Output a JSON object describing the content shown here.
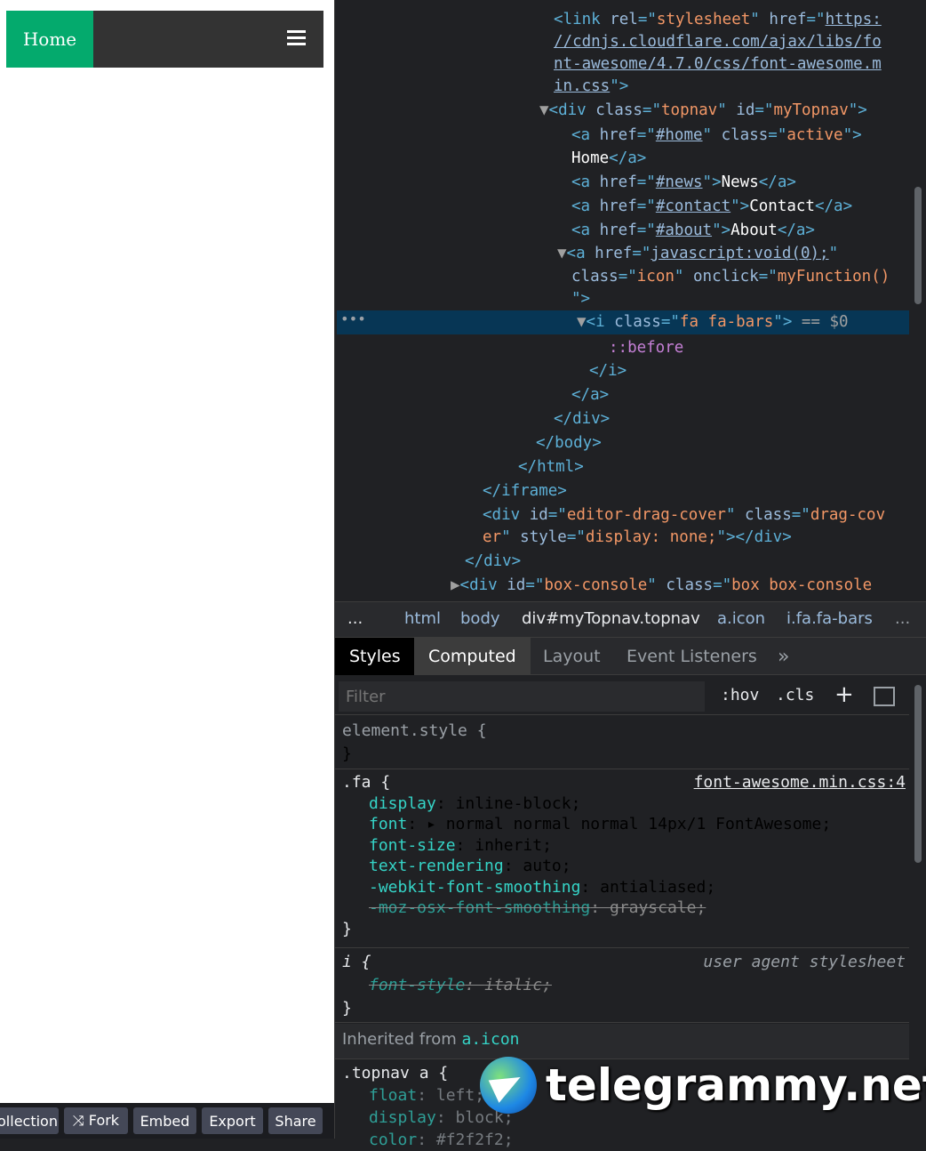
{
  "preview": {
    "nav_home": "Home",
    "menu_icon": "bars-icon"
  },
  "bottom_bar": {
    "collection": "ollection",
    "fork": "⤨ Fork",
    "embed": "Embed",
    "export": "Export",
    "share": "Share"
  },
  "elements_tree": [
    [
      [
        "t",
        "<link "
      ],
      [
        "an",
        "rel"
      ],
      [
        "t",
        "=\""
      ],
      [
        "av",
        "stylesheet"
      ],
      [
        "t",
        "\" "
      ],
      [
        "an",
        "href"
      ],
      [
        "t",
        "=\""
      ],
      [
        "lk",
        "https:"
      ]
    ],
    [
      [
        "lk",
        "//cdnjs.cloudflare.com/ajax/libs/fo"
      ]
    ],
    [
      [
        "lk",
        "nt-awesome/4.7.0/css/font-awesome.m"
      ]
    ],
    [
      [
        "lk",
        "in.css"
      ],
      [
        "t",
        "\">"
      ]
    ],
    [
      [
        "ar",
        "▼"
      ],
      [
        "t",
        "<div "
      ],
      [
        "an",
        "class"
      ],
      [
        "t",
        "=\""
      ],
      [
        "av",
        "topnav"
      ],
      [
        "t",
        "\" "
      ],
      [
        "an",
        "id"
      ],
      [
        "t",
        "=\""
      ],
      [
        "av",
        "myTopnav"
      ],
      [
        "t",
        "\">"
      ]
    ],
    [
      [
        "t",
        "<a "
      ],
      [
        "an",
        "href"
      ],
      [
        "t",
        "=\""
      ],
      [
        "lk",
        "#home"
      ],
      [
        "t",
        "\" "
      ],
      [
        "an",
        "class"
      ],
      [
        "t",
        "=\""
      ],
      [
        "av",
        "active"
      ],
      [
        "t",
        "\">"
      ]
    ],
    [
      [
        "tx",
        "Home"
      ],
      [
        "t",
        "</a>"
      ]
    ],
    [
      [
        "t",
        "<a "
      ],
      [
        "an",
        "href"
      ],
      [
        "t",
        "=\""
      ],
      [
        "lk",
        "#news"
      ],
      [
        "t",
        "\">"
      ],
      [
        "tx",
        "News"
      ],
      [
        "t",
        "</a>"
      ]
    ],
    [
      [
        "t",
        "<a "
      ],
      [
        "an",
        "href"
      ],
      [
        "t",
        "=\""
      ],
      [
        "lk",
        "#contact"
      ],
      [
        "t",
        "\">"
      ],
      [
        "tx",
        "Contact"
      ],
      [
        "t",
        "</a>"
      ]
    ],
    [
      [
        "t",
        "<a "
      ],
      [
        "an",
        "href"
      ],
      [
        "t",
        "=\""
      ],
      [
        "lk",
        "#about"
      ],
      [
        "t",
        "\">"
      ],
      [
        "tx",
        "About"
      ],
      [
        "t",
        "</a>"
      ]
    ],
    [
      [
        "ar",
        "▼"
      ],
      [
        "t",
        "<a "
      ],
      [
        "an",
        "href"
      ],
      [
        "t",
        "=\""
      ],
      [
        "lk",
        "javascript:void(0);"
      ],
      [
        "t",
        "\""
      ]
    ],
    [
      [
        "an",
        "class"
      ],
      [
        "t",
        "=\""
      ],
      [
        "av",
        "icon"
      ],
      [
        "t",
        "\" "
      ],
      [
        "an",
        "onclick"
      ],
      [
        "t",
        "=\""
      ],
      [
        "av",
        "myFunction()"
      ]
    ],
    [
      [
        "t",
        "\">"
      ]
    ],
    [
      [
        "ar",
        "▼"
      ],
      [
        "t",
        "<i "
      ],
      [
        "an",
        "class"
      ],
      [
        "t",
        "=\""
      ],
      [
        "av",
        "fa fa-bars"
      ],
      [
        "t",
        "\">"
      ],
      [
        "ar",
        " == "
      ],
      [
        "ar",
        "$0"
      ]
    ],
    [
      [
        "ps",
        "::before"
      ]
    ],
    [
      [
        "t",
        "</i>"
      ]
    ],
    [
      [
        "t",
        "</a>"
      ]
    ],
    [
      [
        "t",
        "</div>"
      ]
    ],
    [
      [
        "t",
        "</body>"
      ]
    ],
    [
      [
        "t",
        "</html>"
      ]
    ],
    [
      [
        "t",
        "</iframe>"
      ]
    ],
    [
      [
        "t",
        "<div "
      ],
      [
        "an",
        "id"
      ],
      [
        "t",
        "=\""
      ],
      [
        "av",
        "editor-drag-cover"
      ],
      [
        "t",
        "\" "
      ],
      [
        "an",
        "class"
      ],
      [
        "t",
        "=\""
      ],
      [
        "av",
        "drag-cov"
      ]
    ],
    [
      [
        "av",
        "er"
      ],
      [
        "t",
        "\" "
      ],
      [
        "an",
        "style"
      ],
      [
        "t",
        "=\""
      ],
      [
        "av",
        "display: none;"
      ],
      [
        "t",
        "\"></div>"
      ]
    ],
    [
      [
        "t",
        "</div>"
      ]
    ],
    [
      [
        "ar",
        "▶"
      ],
      [
        "t",
        "<div "
      ],
      [
        "an",
        "id"
      ],
      [
        "t",
        "=\""
      ],
      [
        "av",
        "box-console"
      ],
      [
        "t",
        "\" "
      ],
      [
        "an",
        "class"
      ],
      [
        "t",
        "=\""
      ],
      [
        "av",
        "box box-console"
      ]
    ]
  ],
  "breadcrumbs": [
    "...",
    "html",
    "body",
    "div#myTopnav.topnav",
    "a.icon",
    "i.fa.fa-bars",
    "..."
  ],
  "tabs": [
    "Styles",
    "Computed",
    "Layout",
    "Event Listeners",
    "»"
  ],
  "filter": {
    "placeholder": "Filter",
    "hov": ":hov",
    "cls": ".cls",
    "add": "+"
  },
  "rules": {
    "element_style": {
      "selector": "element.style {",
      "close": "}"
    },
    "fa": {
      "selector": ".fa {",
      "source": "font-awesome.min.css:4",
      "close": "}",
      "props": [
        [
          "display",
          "inline-block"
        ],
        [
          "font",
          "▸ normal normal normal 14px/1 FontAwesome"
        ],
        [
          "font-size",
          "inherit"
        ],
        [
          "text-rendering",
          "auto"
        ],
        [
          "-webkit-font-smoothing",
          "antialiased"
        ],
        [
          "-moz-osx-font-smoothing",
          "grayscale"
        ]
      ]
    },
    "i": {
      "selector": "i {",
      "source": "user agent stylesheet",
      "close": "}",
      "props": [
        [
          "font-style",
          "italic"
        ]
      ]
    },
    "inherited_label": "Inherited from ",
    "inherited_from": "a.icon",
    "topnav_a": {
      "selector": ".topnav a {",
      "props": [
        [
          "float",
          "left"
        ],
        [
          "display",
          "block"
        ],
        [
          "color",
          "#f2f2f2"
        ]
      ]
    }
  },
  "watermark": "telegrammy.net"
}
